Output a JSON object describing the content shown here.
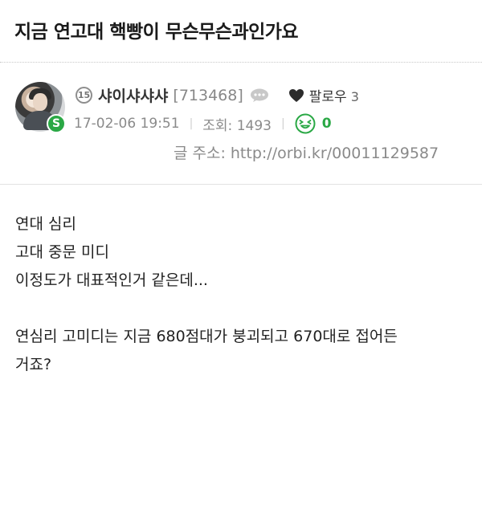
{
  "post": {
    "title": "지금 연고대 핵빵이 무슨무슨과인가요",
    "author": {
      "level": "15",
      "nickname": "샤이샤샤샤",
      "user_id": "[713468]",
      "badge": "S",
      "follow_label": "팔로우",
      "follow_count": "3"
    },
    "date": "17-02-06 19:51",
    "views": "조회: 1493",
    "likes": "0",
    "url_label": "글 주소:",
    "url": "http://orbi.kr/00011129587",
    "body_lines": [
      "연대 심리",
      "고대 중문 미디",
      "이정도가 대표적인거 같은데...",
      "",
      "연심리 고미디는 지금 680점대가 붕괴되고 670대로 접어든",
      "거죠?"
    ]
  },
  "colors": {
    "accent_green": "#2aa845",
    "muted_text": "#8a8a8a"
  },
  "icons": [
    "level-icon",
    "message-icon",
    "heart-icon",
    "smile-icon"
  ]
}
